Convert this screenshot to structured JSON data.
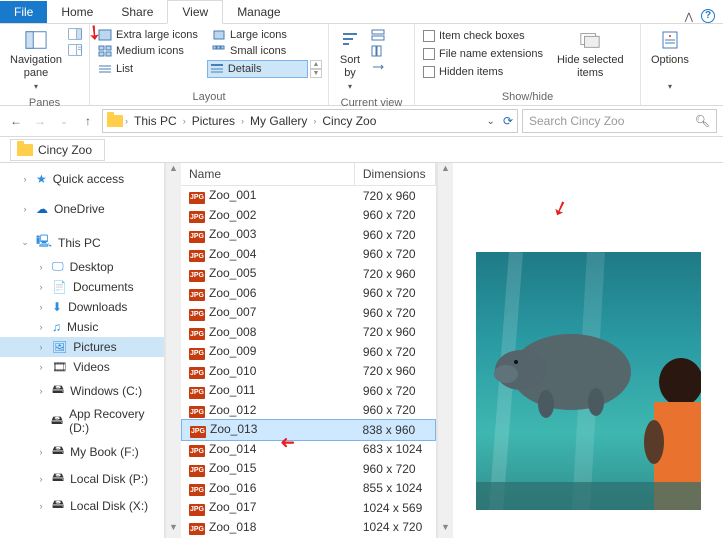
{
  "tabs": {
    "file": "File",
    "home": "Home",
    "share": "Share",
    "view": "View",
    "manage": "Manage"
  },
  "ribbon": {
    "panes": {
      "nav": "Navigation\npane",
      "label": "Panes"
    },
    "layout": {
      "xl": "Extra large icons",
      "lg": "Large icons",
      "md": "Medium icons",
      "sm": "Small icons",
      "list": "List",
      "details": "Details",
      "label": "Layout"
    },
    "currentview": {
      "sortby": "Sort\nby",
      "label": "Current view"
    },
    "showhide": {
      "chk1": "Item check boxes",
      "chk2": "File name extensions",
      "chk3": "Hidden items",
      "hide": "Hide selected\nitems",
      "label": "Show/hide"
    },
    "options": "Options"
  },
  "path": {
    "segs": [
      "This PC",
      "Pictures",
      "My Gallery",
      "Cincy Zoo"
    ],
    "search_placeholder": "Search Cincy Zoo"
  },
  "foldertab": "Cincy Zoo",
  "side": {
    "quick": "Quick access",
    "onedrive": "OneDrive",
    "thispc": "This PC",
    "desktop": "Desktop",
    "documents": "Documents",
    "downloads": "Downloads",
    "music": "Music",
    "pictures": "Pictures",
    "videos": "Videos",
    "cdrive": "Windows (C:)",
    "apprec": "App Recovery (D:)",
    "mybook": "My Book (F:)",
    "ldp": "Local Disk (P:)",
    "ldx": "Local Disk (X:)"
  },
  "columns": {
    "name": "Name",
    "dim": "Dimensions"
  },
  "files": [
    {
      "name": "Zoo_001",
      "dim": "720 x 960"
    },
    {
      "name": "Zoo_002",
      "dim": "960 x 720"
    },
    {
      "name": "Zoo_003",
      "dim": "960 x 720"
    },
    {
      "name": "Zoo_004",
      "dim": "960 x 720"
    },
    {
      "name": "Zoo_005",
      "dim": "720 x 960"
    },
    {
      "name": "Zoo_006",
      "dim": "960 x 720"
    },
    {
      "name": "Zoo_007",
      "dim": "960 x 720"
    },
    {
      "name": "Zoo_008",
      "dim": "720 x 960"
    },
    {
      "name": "Zoo_009",
      "dim": "960 x 720"
    },
    {
      "name": "Zoo_010",
      "dim": "720 x 960"
    },
    {
      "name": "Zoo_011",
      "dim": "960 x 720"
    },
    {
      "name": "Zoo_012",
      "dim": "960 x 720"
    },
    {
      "name": "Zoo_013",
      "dim": "838 x 960",
      "selected": true
    },
    {
      "name": "Zoo_014",
      "dim": "683 x 1024"
    },
    {
      "name": "Zoo_015",
      "dim": "960 x 720"
    },
    {
      "name": "Zoo_016",
      "dim": "855 x 1024"
    },
    {
      "name": "Zoo_017",
      "dim": "1024 x 569"
    },
    {
      "name": "Zoo_018",
      "dim": "1024 x 720"
    }
  ]
}
